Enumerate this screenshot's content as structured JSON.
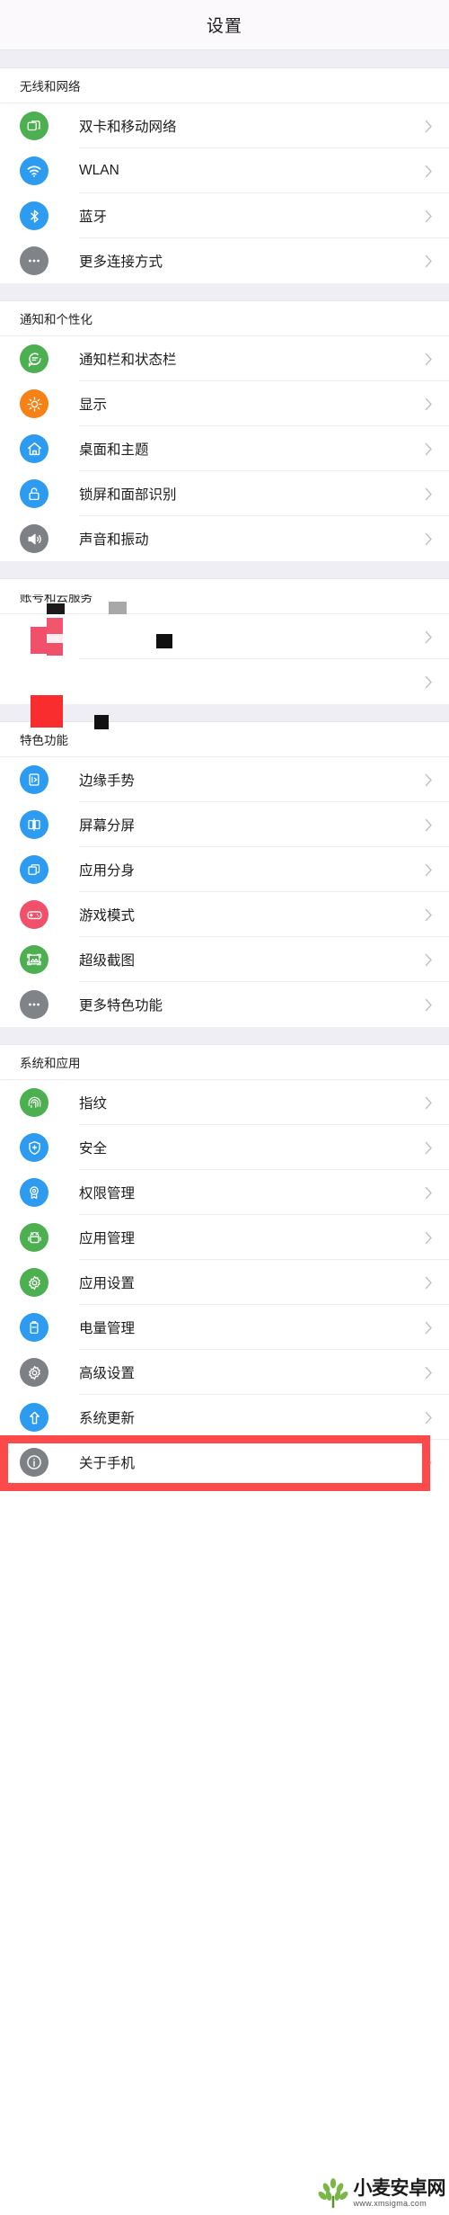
{
  "header": {
    "title": "设置"
  },
  "colors": {
    "group_bg": "#eeeef4",
    "row_bg": "#ffffff",
    "highlight": "#fc4a4a",
    "green": "#4cb050",
    "blue": "#2196f3",
    "orange": "#f78115",
    "gray": "#7d8084",
    "pink": "#f0506a",
    "title_bg": "#fbf9fb"
  },
  "sections": [
    {
      "header": "无线和网络",
      "items": [
        {
          "label": "双卡和移动网络",
          "icon": "sim-card-icon",
          "color": "#4cb050"
        },
        {
          "label": "WLAN",
          "icon": "wifi-icon",
          "color": "#2d9bf0"
        },
        {
          "label": "蓝牙",
          "icon": "bluetooth-icon",
          "color": "#2d9bf0"
        },
        {
          "label": "更多连接方式",
          "icon": "more-dots-icon",
          "color": "#808387"
        }
      ]
    },
    {
      "header": "通知和个性化",
      "items": [
        {
          "label": "通知栏和状态栏",
          "icon": "notification-chat-icon",
          "color": "#4cb050"
        },
        {
          "label": "显示",
          "icon": "brightness-icon",
          "color": "#f78115"
        },
        {
          "label": "桌面和主题",
          "icon": "home-icon",
          "color": "#2d9bf0"
        },
        {
          "label": "锁屏和面部识别",
          "icon": "lock-icon",
          "color": "#2d9bf0"
        },
        {
          "label": "声音和振动",
          "icon": "speaker-icon",
          "color": "#7d8084"
        }
      ]
    },
    {
      "header": "账号和云服务",
      "glitched": true,
      "items": [
        {
          "label": "",
          "icon": "corrupted-icon",
          "color": "#ffffff"
        },
        {
          "label": "",
          "icon": "corrupted-icon",
          "color": "#ffffff"
        }
      ]
    },
    {
      "header": "特色功能",
      "items": [
        {
          "label": "边缘手势",
          "icon": "edge-gesture-icon",
          "color": "#2d9bf0"
        },
        {
          "label": "屏幕分屏",
          "icon": "split-screen-icon",
          "color": "#2d9bf0"
        },
        {
          "label": "应用分身",
          "icon": "app-clone-icon",
          "color": "#2d9bf0"
        },
        {
          "label": "游戏模式",
          "icon": "gamepad-icon",
          "color": "#f0506a"
        },
        {
          "label": "超级截图",
          "icon": "screenshot-icon",
          "color": "#4cb050"
        },
        {
          "label": "更多特色功能",
          "icon": "more-dots-icon",
          "color": "#808387"
        }
      ]
    },
    {
      "header": "系统和应用",
      "items": [
        {
          "label": "指纹",
          "icon": "fingerprint-icon",
          "color": "#4cb050"
        },
        {
          "label": "安全",
          "icon": "shield-icon",
          "color": "#2d9bf0"
        },
        {
          "label": "权限管理",
          "icon": "permission-badge-icon",
          "color": "#2d9bf0"
        },
        {
          "label": "应用管理",
          "icon": "android-robot-icon",
          "color": "#4cb050"
        },
        {
          "label": "应用设置",
          "icon": "gear-icon",
          "color": "#4cb050"
        },
        {
          "label": "电量管理",
          "icon": "battery-icon",
          "color": "#2d9bf0"
        },
        {
          "label": "高级设置",
          "icon": "gear-icon",
          "color": "#7d8084"
        },
        {
          "label": "系统更新",
          "icon": "up-arrow-icon",
          "color": "#2d9bf0"
        },
        {
          "label": "关于手机",
          "icon": "info-icon",
          "color": "#7d8084",
          "highlighted": true
        }
      ]
    }
  ],
  "watermark": {
    "title": "小麦安卓网",
    "url": "www.xmsigma.com"
  }
}
